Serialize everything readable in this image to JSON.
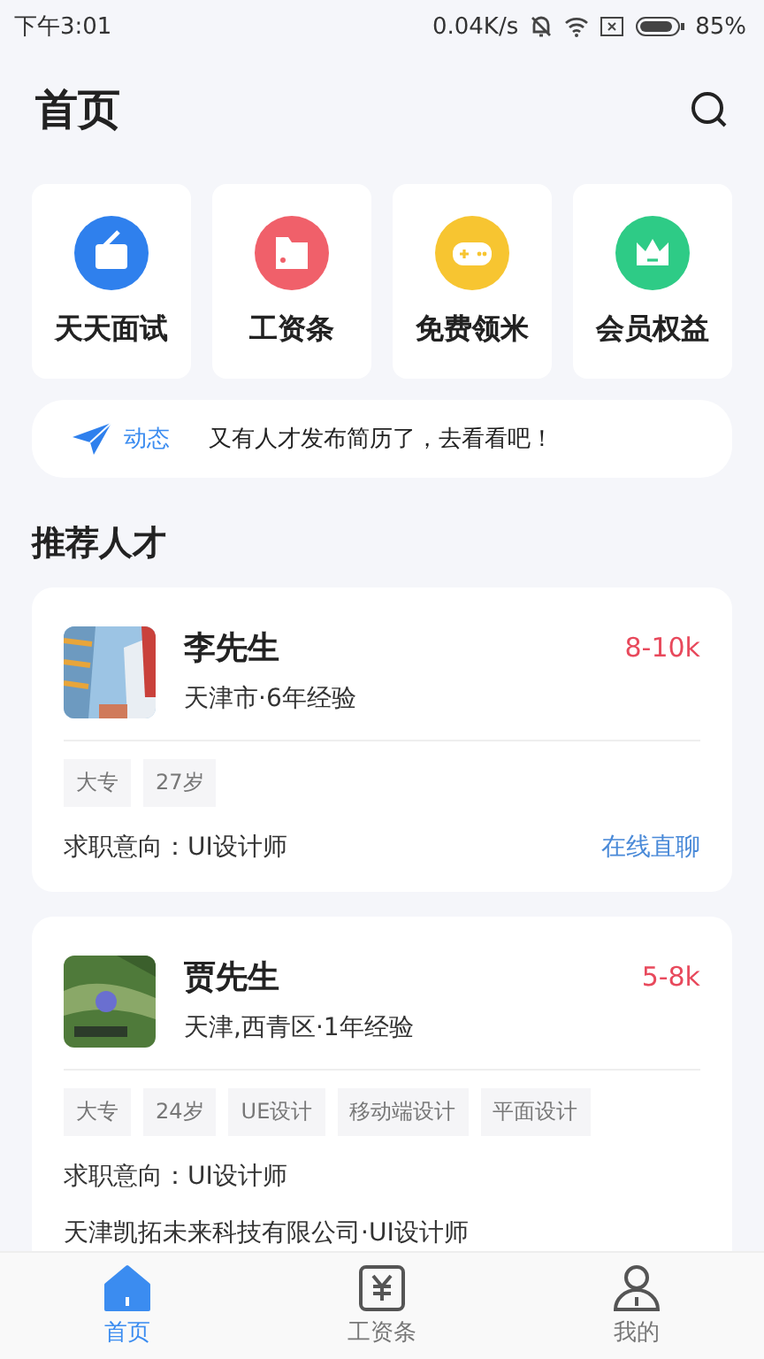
{
  "status_bar": {
    "time": "下午3:01",
    "speed": "0.04K/s",
    "battery": "85%"
  },
  "header": {
    "title": "首页"
  },
  "shortcuts": [
    {
      "label": "天天面试",
      "kind": "interview",
      "color": "#2f80ed"
    },
    {
      "label": "工资条",
      "kind": "payslip",
      "color": "#f0606a"
    },
    {
      "label": "免费领米",
      "kind": "game",
      "color": "#f7c531"
    },
    {
      "label": "会员权益",
      "kind": "vip",
      "color": "#2ecb86"
    }
  ],
  "notice": {
    "tag": "动态",
    "text": "又有人才发布简历了，去看看吧！"
  },
  "section_title": "推荐人才",
  "candidates": [
    {
      "name": "李先生",
      "salary": "8-10k",
      "meta": "天津市·6年经验",
      "tags": [
        "大专",
        "27岁"
      ],
      "intent": "求职意向：UI设计师",
      "action": "在线直聊"
    },
    {
      "name": "贾先生",
      "salary": "5-8k",
      "meta": "天津,西青区·1年经验",
      "tags": [
        "大专",
        "24岁",
        "UE设计",
        "移动端设计",
        "平面设计"
      ],
      "intent": "求职意向：UI设计师",
      "history": "天津凯拓未来科技有限公司·UI设计师"
    }
  ],
  "tab_bar": [
    {
      "label": "首页",
      "kind": "home",
      "selected": true
    },
    {
      "label": "工资条",
      "kind": "payslip",
      "selected": false
    },
    {
      "label": "我的",
      "kind": "profile",
      "selected": false
    }
  ]
}
